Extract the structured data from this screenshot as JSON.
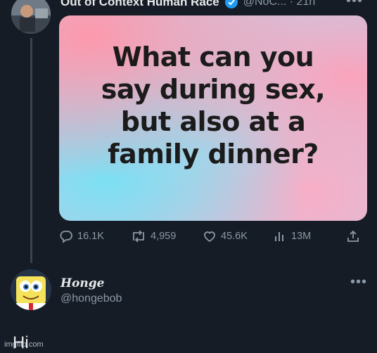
{
  "tweet": {
    "display_name": "Out of Context Human Race",
    "handle_time": "@NoC... · 21h",
    "more_label": "•••",
    "image_text": [
      "What can you",
      "say during sex,",
      "but also at a",
      "family dinner?"
    ]
  },
  "actions": {
    "replies": "16.1K",
    "retweets": "4,959",
    "likes": "45.6K",
    "views": "13M"
  },
  "reply": {
    "display_name": "Honge",
    "handle": "@hongebob",
    "more_label": "•••",
    "text": "Hi"
  },
  "watermark": "imgflip.com",
  "colors": {
    "background": "#151c26",
    "verified": "#1d9bf0",
    "muted": "#8b98a5"
  },
  "icons": [
    "verified-badge-icon",
    "reply-icon",
    "retweet-icon",
    "like-icon",
    "views-icon",
    "share-icon",
    "more-icon"
  ]
}
